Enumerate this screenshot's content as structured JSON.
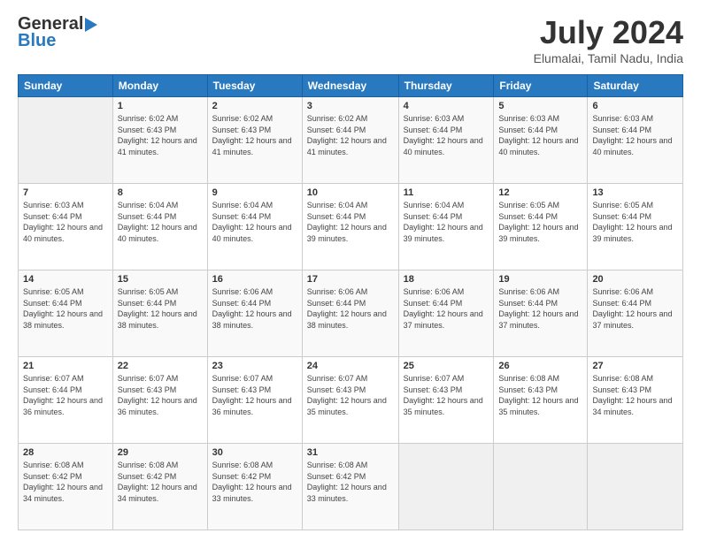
{
  "logo": {
    "line1": "General",
    "line2": "Blue"
  },
  "header": {
    "month": "July 2024",
    "location": "Elumalai, Tamil Nadu, India"
  },
  "days_of_week": [
    "Sunday",
    "Monday",
    "Tuesday",
    "Wednesday",
    "Thursday",
    "Friday",
    "Saturday"
  ],
  "weeks": [
    [
      {
        "day": "",
        "info": ""
      },
      {
        "day": "1",
        "info": "Sunrise: 6:02 AM\nSunset: 6:43 PM\nDaylight: 12 hours and 41 minutes."
      },
      {
        "day": "2",
        "info": "Sunrise: 6:02 AM\nSunset: 6:43 PM\nDaylight: 12 hours and 41 minutes."
      },
      {
        "day": "3",
        "info": "Sunrise: 6:02 AM\nSunset: 6:44 PM\nDaylight: 12 hours and 41 minutes."
      },
      {
        "day": "4",
        "info": "Sunrise: 6:03 AM\nSunset: 6:44 PM\nDaylight: 12 hours and 40 minutes."
      },
      {
        "day": "5",
        "info": "Sunrise: 6:03 AM\nSunset: 6:44 PM\nDaylight: 12 hours and 40 minutes."
      },
      {
        "day": "6",
        "info": "Sunrise: 6:03 AM\nSunset: 6:44 PM\nDaylight: 12 hours and 40 minutes."
      }
    ],
    [
      {
        "day": "7",
        "info": "Sunrise: 6:03 AM\nSunset: 6:44 PM\nDaylight: 12 hours and 40 minutes."
      },
      {
        "day": "8",
        "info": "Sunrise: 6:04 AM\nSunset: 6:44 PM\nDaylight: 12 hours and 40 minutes."
      },
      {
        "day": "9",
        "info": "Sunrise: 6:04 AM\nSunset: 6:44 PM\nDaylight: 12 hours and 40 minutes."
      },
      {
        "day": "10",
        "info": "Sunrise: 6:04 AM\nSunset: 6:44 PM\nDaylight: 12 hours and 39 minutes."
      },
      {
        "day": "11",
        "info": "Sunrise: 6:04 AM\nSunset: 6:44 PM\nDaylight: 12 hours and 39 minutes."
      },
      {
        "day": "12",
        "info": "Sunrise: 6:05 AM\nSunset: 6:44 PM\nDaylight: 12 hours and 39 minutes."
      },
      {
        "day": "13",
        "info": "Sunrise: 6:05 AM\nSunset: 6:44 PM\nDaylight: 12 hours and 39 minutes."
      }
    ],
    [
      {
        "day": "14",
        "info": "Sunrise: 6:05 AM\nSunset: 6:44 PM\nDaylight: 12 hours and 38 minutes."
      },
      {
        "day": "15",
        "info": "Sunrise: 6:05 AM\nSunset: 6:44 PM\nDaylight: 12 hours and 38 minutes."
      },
      {
        "day": "16",
        "info": "Sunrise: 6:06 AM\nSunset: 6:44 PM\nDaylight: 12 hours and 38 minutes."
      },
      {
        "day": "17",
        "info": "Sunrise: 6:06 AM\nSunset: 6:44 PM\nDaylight: 12 hours and 38 minutes."
      },
      {
        "day": "18",
        "info": "Sunrise: 6:06 AM\nSunset: 6:44 PM\nDaylight: 12 hours and 37 minutes."
      },
      {
        "day": "19",
        "info": "Sunrise: 6:06 AM\nSunset: 6:44 PM\nDaylight: 12 hours and 37 minutes."
      },
      {
        "day": "20",
        "info": "Sunrise: 6:06 AM\nSunset: 6:44 PM\nDaylight: 12 hours and 37 minutes."
      }
    ],
    [
      {
        "day": "21",
        "info": "Sunrise: 6:07 AM\nSunset: 6:44 PM\nDaylight: 12 hours and 36 minutes."
      },
      {
        "day": "22",
        "info": "Sunrise: 6:07 AM\nSunset: 6:43 PM\nDaylight: 12 hours and 36 minutes."
      },
      {
        "day": "23",
        "info": "Sunrise: 6:07 AM\nSunset: 6:43 PM\nDaylight: 12 hours and 36 minutes."
      },
      {
        "day": "24",
        "info": "Sunrise: 6:07 AM\nSunset: 6:43 PM\nDaylight: 12 hours and 35 minutes."
      },
      {
        "day": "25",
        "info": "Sunrise: 6:07 AM\nSunset: 6:43 PM\nDaylight: 12 hours and 35 minutes."
      },
      {
        "day": "26",
        "info": "Sunrise: 6:08 AM\nSunset: 6:43 PM\nDaylight: 12 hours and 35 minutes."
      },
      {
        "day": "27",
        "info": "Sunrise: 6:08 AM\nSunset: 6:43 PM\nDaylight: 12 hours and 34 minutes."
      }
    ],
    [
      {
        "day": "28",
        "info": "Sunrise: 6:08 AM\nSunset: 6:42 PM\nDaylight: 12 hours and 34 minutes."
      },
      {
        "day": "29",
        "info": "Sunrise: 6:08 AM\nSunset: 6:42 PM\nDaylight: 12 hours and 34 minutes."
      },
      {
        "day": "30",
        "info": "Sunrise: 6:08 AM\nSunset: 6:42 PM\nDaylight: 12 hours and 33 minutes."
      },
      {
        "day": "31",
        "info": "Sunrise: 6:08 AM\nSunset: 6:42 PM\nDaylight: 12 hours and 33 minutes."
      },
      {
        "day": "",
        "info": ""
      },
      {
        "day": "",
        "info": ""
      },
      {
        "day": "",
        "info": ""
      }
    ]
  ]
}
